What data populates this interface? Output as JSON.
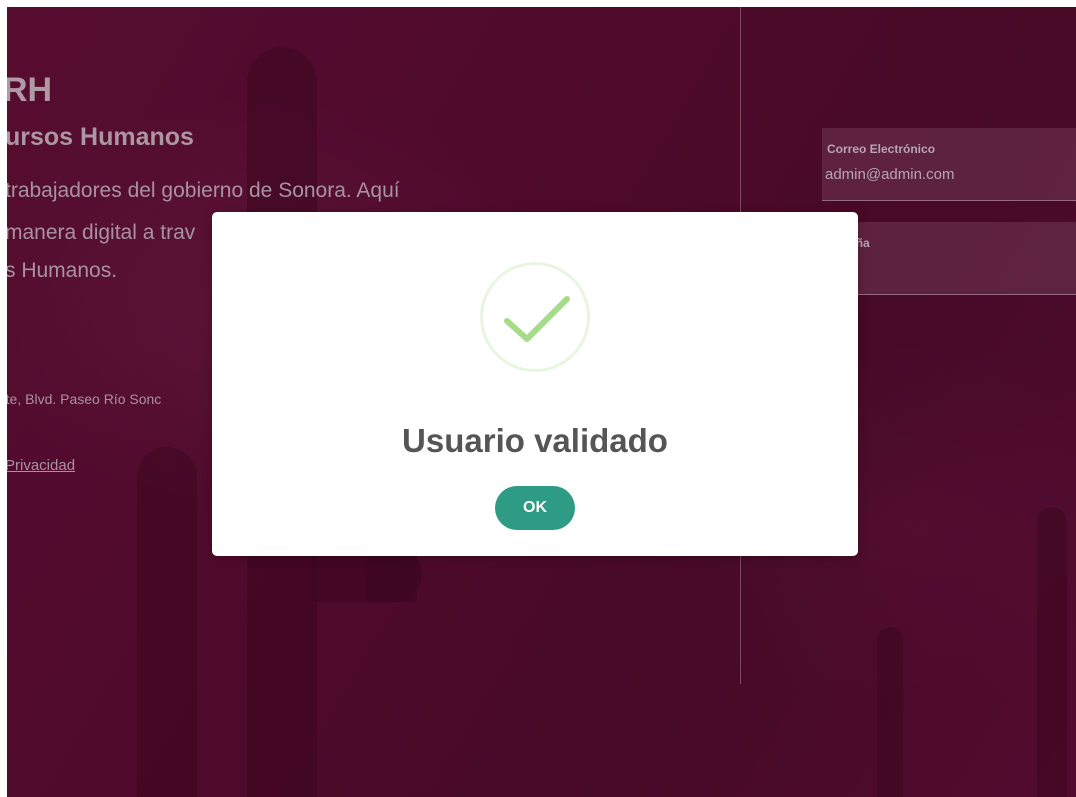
{
  "app": {
    "title": "RH",
    "subtitle": "ursos Humanos",
    "description": [
      "trabajadores del gobierno de Sonora. Aquí",
      "manera digital a trav",
      "s Humanos."
    ],
    "address": "rte, Blvd. Paseo Río Sonc",
    "privacy_link": "Privacidad"
  },
  "login": {
    "email_label": "Correo Electrónico",
    "email_value": "admin@admin.com",
    "password_label": "traseña",
    "password_value": ""
  },
  "dialog": {
    "icon": "check-icon",
    "title": "Usuario validado",
    "ok_label": "OK"
  },
  "colors": {
    "background": "#560b2f",
    "success_icon": "#a5dc86",
    "ok_button": "#2e9b84",
    "title_text": "#555555"
  }
}
